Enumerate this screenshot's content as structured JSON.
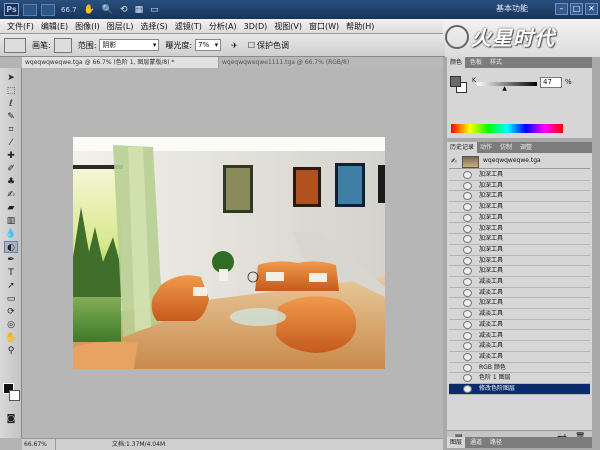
{
  "app": {
    "logo_text": "Ps",
    "zoom_label": "66.7",
    "workspace": "基本功能",
    "window_controls": [
      "–",
      "□",
      "✕"
    ]
  },
  "menu": {
    "items": [
      "文件(F)",
      "编辑(E)",
      "图像(I)",
      "图层(L)",
      "选择(S)",
      "滤镜(T)",
      "分析(A)",
      "3D(D)",
      "视图(V)",
      "窗口(W)",
      "帮助(H)"
    ]
  },
  "brand": {
    "text": "火星时代"
  },
  "options": {
    "brush_label": "画笔:",
    "range_label": "范围:",
    "range_value": "阴影",
    "exposure_label": "曝光度:",
    "exposure_value": "7%",
    "protect_label": "保护色调"
  },
  "documents": {
    "tabs": [
      "wqeqwqweqwe.tga @ 66.7% (色阶 1, 图层蒙版/8) *",
      "wqeqwqweqwe1111.tga @ 66.7% (RGB/8)"
    ]
  },
  "status": {
    "zoom": "66.67%",
    "doc_size": "文档:1.37M/4.04M"
  },
  "color_panel": {
    "tabs": [
      "颜色",
      "色板",
      "样式"
    ],
    "channel_label": "K",
    "k_value": "47",
    "k_unit": "%",
    "k_fraction": 0.47,
    "fg_color": "#6a6a6a",
    "bg_color": "#ffffff"
  },
  "history_panel": {
    "tabs": [
      "历史记录",
      "动作",
      "仿制",
      "调整"
    ],
    "snapshot_name": "wqeqwqweqwe.tga",
    "items": [
      {
        "label": "加深工具",
        "icon": "burn"
      },
      {
        "label": "加深工具",
        "icon": "burn"
      },
      {
        "label": "加深工具",
        "icon": "burn"
      },
      {
        "label": "加深工具",
        "icon": "burn"
      },
      {
        "label": "加深工具",
        "icon": "burn"
      },
      {
        "label": "加深工具",
        "icon": "burn"
      },
      {
        "label": "加深工具",
        "icon": "burn"
      },
      {
        "label": "加深工具",
        "icon": "burn"
      },
      {
        "label": "加深工具",
        "icon": "burn"
      },
      {
        "label": "加深工具",
        "icon": "burn"
      },
      {
        "label": "减淡工具",
        "icon": "dodge"
      },
      {
        "label": "减淡工具",
        "icon": "dodge"
      },
      {
        "label": "加深工具",
        "icon": "burn"
      },
      {
        "label": "减淡工具",
        "icon": "dodge"
      },
      {
        "label": "减淡工具",
        "icon": "dodge"
      },
      {
        "label": "减淡工具",
        "icon": "dodge"
      },
      {
        "label": "减淡工具",
        "icon": "dodge"
      },
      {
        "label": "减淡工具",
        "icon": "dodge"
      },
      {
        "label": "RGB 颜色",
        "icon": "doc"
      },
      {
        "label": "色阶 1 图层",
        "icon": "doc"
      },
      {
        "label": "修改色阶图层",
        "icon": "doc",
        "selected": true
      }
    ]
  },
  "layers_tabs": [
    "图层",
    "通道",
    "路径"
  ]
}
